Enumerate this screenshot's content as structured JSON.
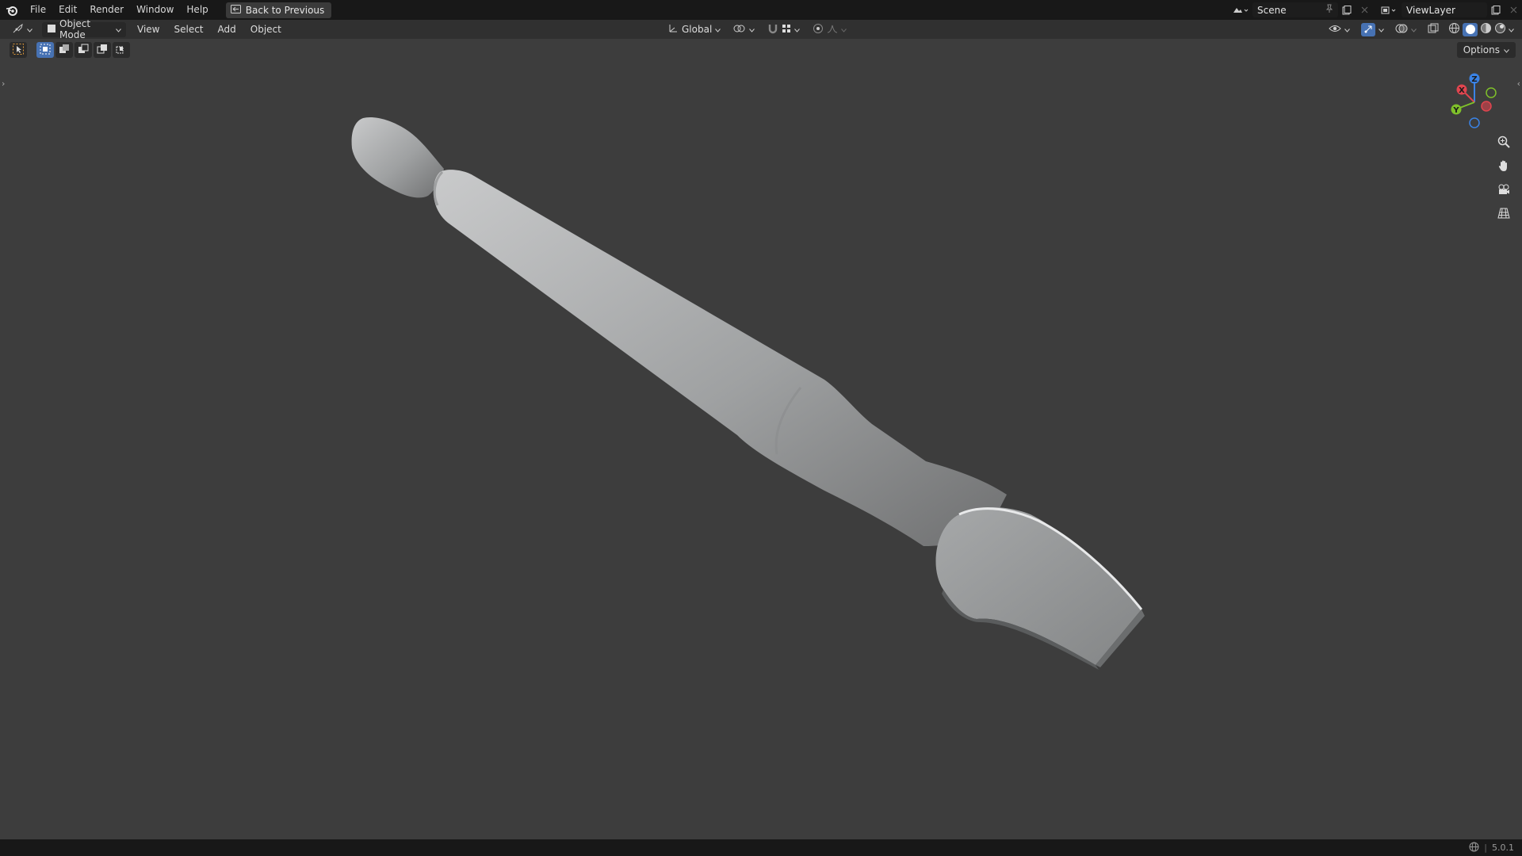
{
  "menu": {
    "file": "File",
    "edit": "Edit",
    "render": "Render",
    "window": "Window",
    "help": "Help",
    "back_to_previous": "Back to Previous"
  },
  "topbar_right": {
    "scene": "Scene",
    "view_layer": "ViewLayer"
  },
  "header": {
    "mode": "Object Mode",
    "view": "View",
    "select": "Select",
    "add": "Add",
    "object": "Object",
    "transform_orientation": "Global"
  },
  "viewport": {
    "options": "Options"
  },
  "gizmo": {
    "x": "X",
    "y": "Y",
    "z": "Z",
    "colors": {
      "x": "#e0454f",
      "y": "#7fc02a",
      "z": "#3a83e6"
    }
  },
  "status": {
    "version": "5.0.1"
  },
  "colors": {
    "topbar": "#181818",
    "header": "#303030",
    "viewport": "#3d3d3d",
    "accent": "#4772b3"
  }
}
